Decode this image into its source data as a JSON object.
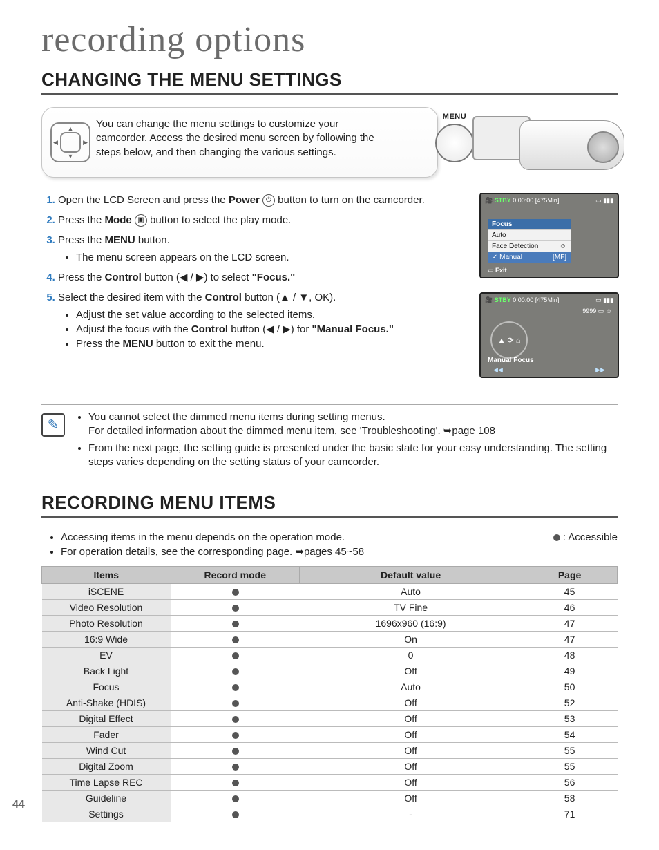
{
  "page_number": "44",
  "chapter_title": "recording options",
  "section1_title": "CHANGING THE MENU SETTINGS",
  "intro_text": "You can change the menu settings to customize your camcorder. Access the desired menu screen by following the steps below, and then changing the various settings.",
  "menu_button_label": "MENU",
  "steps": {
    "s1a": "Open the LCD Screen and press the ",
    "s1b": "Power",
    "s1c": " button to turn on the camcorder.",
    "s2a": "Press the ",
    "s2b": "Mode",
    "s2c": " button to select the play mode.",
    "s3a": "Press the ",
    "s3b": "MENU",
    "s3c": " button.",
    "s3_sub1": "The menu screen appears on the LCD screen.",
    "s4a": "Press the ",
    "s4b": "Control",
    "s4c": " button (◀ / ▶) to select ",
    "s4d": "\"Focus.\"",
    "s5a": "Select the desired item with the ",
    "s5b": "Control",
    "s5c": " button (▲ / ▼, OK).",
    "s5_sub1": "Adjust the set value according to the selected items.",
    "s5_sub2a": "Adjust the focus with the ",
    "s5_sub2b": "Control",
    "s5_sub2c": " button (◀ / ▶) for ",
    "s5_sub2d": "\"Manual Focus.\"",
    "s5_sub3a": "Press the ",
    "s5_sub3b": "MENU",
    "s5_sub3c": " button to exit the menu."
  },
  "lcd1": {
    "stby": "STBY",
    "time": "0:00:00",
    "remain": "[475Min]",
    "menu_title": "Focus",
    "opt1": "Auto",
    "opt2": "Face Detection",
    "opt3": "Manual",
    "exit_label": "Exit"
  },
  "lcd2": {
    "stby": "STBY",
    "time": "0:00:00",
    "remain": "[475Min]",
    "counter": "9999",
    "mf_label": "Manual Focus"
  },
  "notes": {
    "n1a": "You cannot select the dimmed menu items during setting menus.",
    "n1b": "For detailed information about the dimmed menu item, see 'Troubleshooting'. ➥page 108",
    "n2": "From the next page, the setting guide is presented under the basic state for your easy understanding. The setting steps varies depending on the setting status of your camcorder."
  },
  "section2_title": "RECORDING MENU ITEMS",
  "pre_table": {
    "b1": "Accessing items in the menu depends on the operation mode.",
    "b2": "For operation details, see the corresponding page. ➥pages 45~58"
  },
  "legend_text": " : Accessible",
  "table_headers": {
    "c1": "Items",
    "c2": "Record mode",
    "c3": "Default value",
    "c4": "Page"
  },
  "table_rows": [
    {
      "item": "iSCENE",
      "default": "Auto",
      "page": "45"
    },
    {
      "item": "Video Resolution",
      "default": "TV Fine",
      "page": "46"
    },
    {
      "item": "Photo Resolution",
      "default": "1696x960 (16:9)",
      "page": "47"
    },
    {
      "item": "16:9 Wide",
      "default": "On",
      "page": "47"
    },
    {
      "item": "EV",
      "default": "0",
      "page": "48"
    },
    {
      "item": "Back Light",
      "default": "Off",
      "page": "49"
    },
    {
      "item": "Focus",
      "default": "Auto",
      "page": "50"
    },
    {
      "item": "Anti-Shake (HDIS)",
      "default": "Off",
      "page": "52"
    },
    {
      "item": "Digital Effect",
      "default": "Off",
      "page": "53"
    },
    {
      "item": "Fader",
      "default": "Off",
      "page": "54"
    },
    {
      "item": "Wind Cut",
      "default": "Off",
      "page": "55"
    },
    {
      "item": "Digital Zoom",
      "default": "Off",
      "page": "55"
    },
    {
      "item": "Time Lapse REC",
      "default": "Off",
      "page": "56"
    },
    {
      "item": "Guideline",
      "default": "Off",
      "page": "58"
    },
    {
      "item": "Settings",
      "default": "-",
      "page": "71"
    }
  ]
}
